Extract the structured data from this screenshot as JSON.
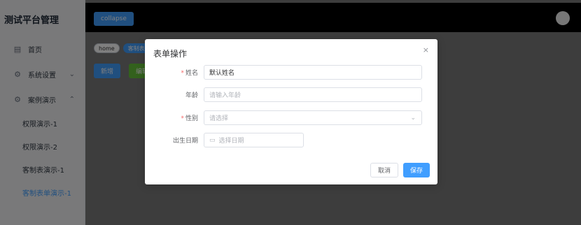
{
  "sidebar": {
    "brand": "测试平台管理",
    "items": [
      {
        "label": "首页",
        "icon": "document-icon"
      },
      {
        "label": "系统设置",
        "icon": "gear-icon",
        "chevron": "⌄"
      },
      {
        "label": "案例演示",
        "icon": "gear-icon",
        "chevron": "⌃"
      }
    ],
    "subitems": [
      {
        "label": "权限演示-1"
      },
      {
        "label": "权限演示-2"
      },
      {
        "label": "客制表演示-1"
      },
      {
        "label": "客制表单演示-1",
        "active": true
      }
    ]
  },
  "topbar": {
    "collapse_label": "collapse"
  },
  "tags": [
    {
      "label": "home",
      "active": false
    },
    {
      "label": "客制表",
      "active": true
    }
  ],
  "actions": [
    {
      "label": "新增",
      "color": "#409eff"
    },
    {
      "label": "编辑",
      "color": "#67c23a"
    }
  ],
  "dialog": {
    "title": "表单操作",
    "close_symbol": "×",
    "required_mark": "*",
    "fields": {
      "name": {
        "label": "姓名",
        "value": "默认姓名"
      },
      "age": {
        "label": "年龄",
        "placeholder": "请输入年龄"
      },
      "gender": {
        "label": "性别",
        "placeholder": "请选择"
      },
      "birthday": {
        "label": "出生日期",
        "placeholder": "选择日期"
      }
    },
    "cancel_label": "取消",
    "save_label": "保存"
  },
  "colors": {
    "primary": "#409eff",
    "success": "#67c23a",
    "required": "#f56c6c",
    "topbar": "#000000"
  }
}
